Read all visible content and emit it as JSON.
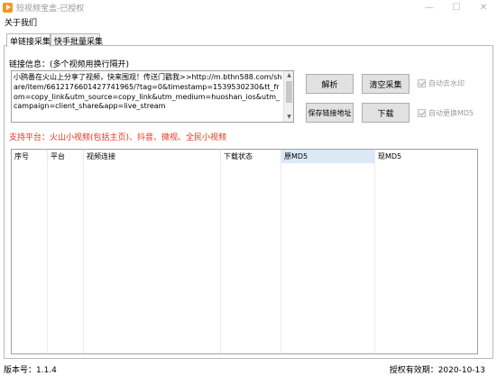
{
  "window": {
    "title": "短视频宝盒-已授权",
    "controls": {
      "minimize": "—",
      "maximize": "☐",
      "close": "✕"
    }
  },
  "menu": {
    "about": "关于我们"
  },
  "tabs": [
    {
      "label": "单链接采集",
      "active": true
    },
    {
      "label": "快手批量采集",
      "active": false
    }
  ],
  "link_section": {
    "label": "链接信息：(多个视频用换行隔开)",
    "value": "小鸥番在火山上分享了视频，快来围观！传送门戳我>>http://m.bthn588.com/share/item/6612176601427741965/?tag=0&timestamp=1539530230&tt_from=copy_link&utm_source=copy_link&utm_medium=huoshan_ios&utm_campaign=client_share&app=live_stream"
  },
  "buttons": {
    "parse": "解析",
    "clear": "清空采集",
    "save_link": "保存链接地址",
    "download": "下载"
  },
  "options": {
    "remove_watermark": {
      "label": "自动去水印",
      "checked": true,
      "enabled": false
    },
    "change_md5": {
      "label": "自动更换MD5",
      "checked": true,
      "enabled": false
    }
  },
  "platforms_text": "支持平台：火山小视频(包括主页)、抖音、微视、全民小视频",
  "table": {
    "columns": [
      "序号",
      "平台",
      "视频连接",
      "下载状态",
      "原MD5",
      "现MD5"
    ],
    "rows": []
  },
  "status": {
    "version": "版本号：1.1.4",
    "expiry": "授权有效期：2020-10-13"
  },
  "colors": {
    "accent_red": "#e8331e",
    "selected_header": "#dbe9f7",
    "app_icon": "#f29a1f"
  }
}
